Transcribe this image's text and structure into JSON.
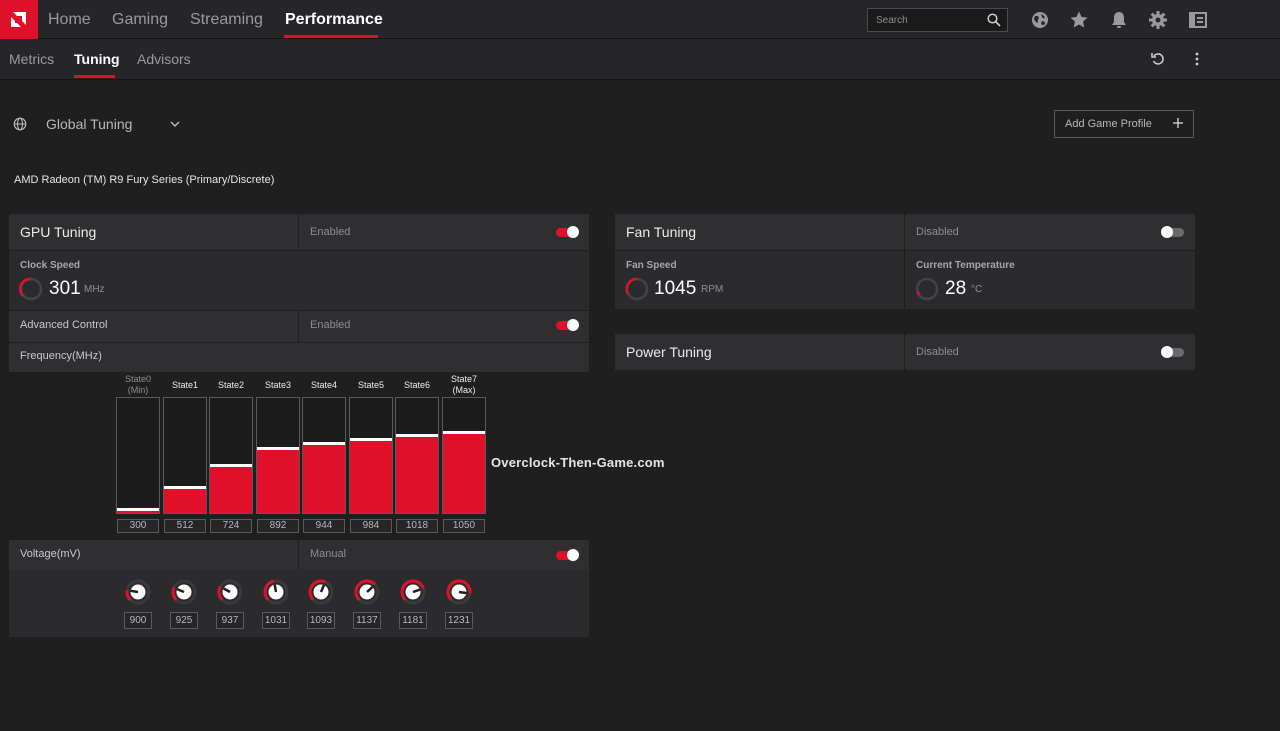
{
  "nav": {
    "items": [
      "Home",
      "Gaming",
      "Streaming",
      "Performance"
    ],
    "active": "Performance"
  },
  "search": {
    "placeholder": "Search"
  },
  "subnav": {
    "items": [
      "Metrics",
      "Tuning",
      "Advisors"
    ],
    "active": "Tuning"
  },
  "profile": {
    "label": "Global Tuning",
    "add_button": "Add Game Profile"
  },
  "gpu_name": "AMD Radeon (TM) R9 Fury Series (Primary/Discrete)",
  "gpu_tuning": {
    "title": "GPU Tuning",
    "status": "Enabled",
    "enabled": true,
    "clock_label": "Clock Speed",
    "clock_value": "301",
    "clock_unit": "MHz",
    "advanced_label": "Advanced Control",
    "advanced_status": "Enabled",
    "frequency_label": "Frequency(MHz)",
    "states": [
      {
        "name": "State0",
        "sub": "(Min)",
        "value": 300
      },
      {
        "name": "State1",
        "sub": "",
        "value": 512
      },
      {
        "name": "State2",
        "sub": "",
        "value": 724
      },
      {
        "name": "State3",
        "sub": "",
        "value": 892
      },
      {
        "name": "State4",
        "sub": "",
        "value": 944
      },
      {
        "name": "State5",
        "sub": "",
        "value": 984
      },
      {
        "name": "State6",
        "sub": "",
        "value": 1018
      },
      {
        "name": "State7",
        "sub": "(Max)",
        "value": 1050
      }
    ],
    "voltage_label": "Voltage(mV)",
    "voltage_status": "Manual",
    "voltages": [
      900,
      925,
      937,
      1031,
      1093,
      1137,
      1181,
      1231
    ]
  },
  "fan_tuning": {
    "title": "Fan Tuning",
    "status": "Disabled",
    "fan_label": "Fan Speed",
    "fan_value": "1045",
    "fan_unit": "RPM",
    "temp_label": "Current Temperature",
    "temp_value": "28",
    "temp_unit": "°C"
  },
  "power_tuning": {
    "title": "Power Tuning",
    "status": "Disabled"
  },
  "watermark": "Overclock-Then-Game.com",
  "colors": {
    "accent": "#e0102a",
    "background": "#1f1f20",
    "panel": "#2b2b2d"
  }
}
